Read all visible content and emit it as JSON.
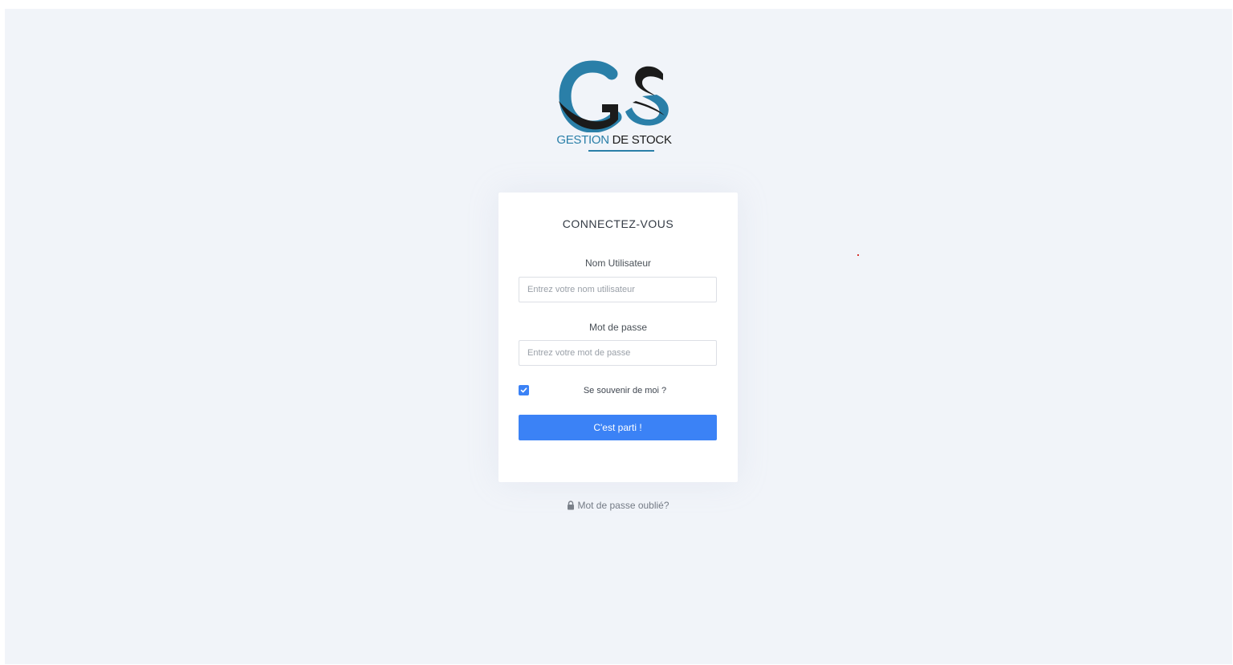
{
  "logo": {
    "letters": "GS",
    "caption_part1": "GESTION",
    "caption_part2": "DE STOCK"
  },
  "login": {
    "title": "CONNECTEZ-VOUS",
    "username_label": "Nom Utilisateur",
    "username_placeholder": "Entrez votre nom utilisateur",
    "password_label": "Mot de passe",
    "password_placeholder": "Entrez votre mot de passe",
    "remember_label": "Se souvenir de moi ?",
    "remember_checked": true,
    "submit_label": "C'est parti !"
  },
  "forgot_password": {
    "label": "Mot de passe oublié?",
    "icon": "lock-icon"
  },
  "colors": {
    "page_bg": "#f1f4f9",
    "accent": "#3b82f6",
    "brand_blue": "#2a7fa8",
    "brand_dark": "#1b1b1b"
  }
}
